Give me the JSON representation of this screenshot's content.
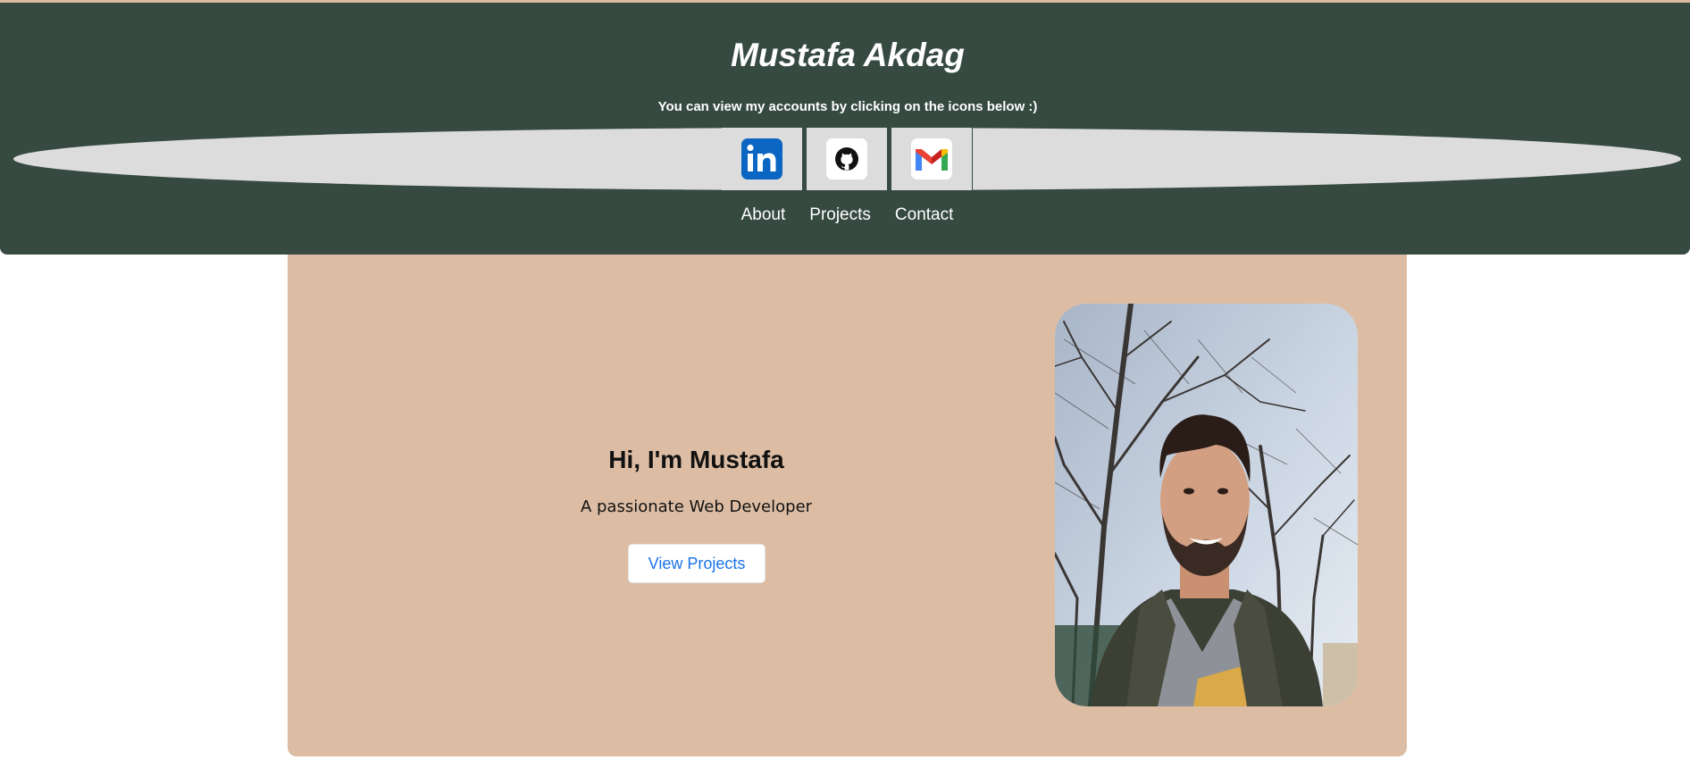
{
  "header": {
    "title": "Mustafa Akdag",
    "subtitle": "You can view my accounts by clicking on the icons below :)",
    "background": "#364a41",
    "social": [
      {
        "name": "LinkedIn",
        "icon": "linkedin-icon"
      },
      {
        "name": "GitHub",
        "icon": "github-icon"
      },
      {
        "name": "Gmail",
        "icon": "gmail-icon"
      }
    ],
    "nav": [
      {
        "label": "About"
      },
      {
        "label": "Projects"
      },
      {
        "label": "Contact"
      }
    ]
  },
  "hero": {
    "heading": "Hi, I'm Mustafa",
    "tagline": "A passionate Web Developer",
    "button_label": "View Projects",
    "background": "#dcbda4",
    "photo": "profile-photo"
  },
  "colors": {
    "accent_link": "#1a73e8",
    "ellipse": "#dcdcdc"
  }
}
